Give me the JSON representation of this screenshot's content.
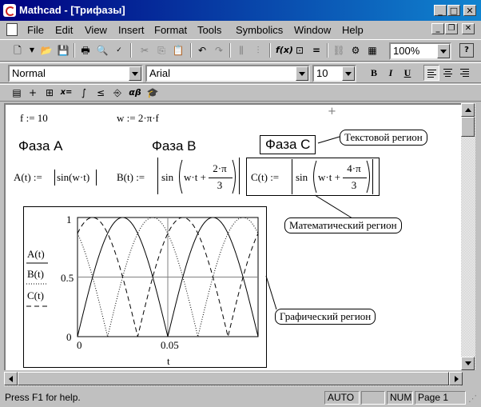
{
  "window": {
    "title": "Mathcad - [Трифазы]"
  },
  "menu": [
    "File",
    "Edit",
    "View",
    "Insert",
    "Format",
    "Tools",
    "Symbolics",
    "Window",
    "Help"
  ],
  "toolbar": {
    "zoom": "100%"
  },
  "format": {
    "style": "Normal",
    "font": "Arial",
    "size": "10",
    "bold": "B",
    "italic": "I",
    "underline": "U"
  },
  "math_palette": {
    "eval": "x=",
    "greek": "αβ"
  },
  "worksheet": {
    "f_def": "f := 10",
    "w_def": "w := 2·π·f",
    "heading_a": "Фаза A",
    "heading_b": "Фаза B",
    "heading_c": "Фаза C",
    "a_def_left": "A(t) :=",
    "a_def_body": "sin(w·t)",
    "b_def_left": "B(t) :=",
    "b_def_sin": "sin",
    "b_def_inner": "w·t +",
    "b_frac_num": "2·π",
    "b_frac_den": "3",
    "c_def_left": "C(t) :=",
    "c_def_sin": "sin",
    "c_def_inner": "w·t +",
    "c_frac_num": "4·π",
    "c_frac_den": "3"
  },
  "callouts": {
    "text_region": "Текстовой регион",
    "math_region": "Математический регион",
    "graph_region": "Графический регион"
  },
  "chart_data": {
    "type": "line",
    "x_range": [
      0,
      0.1
    ],
    "ylim": [
      0,
      1
    ],
    "x_ticks": [
      "0",
      "0.05"
    ],
    "y_ticks": [
      "0",
      "0.5",
      "1"
    ],
    "xlabel": "t",
    "series": [
      {
        "name": "A(t)",
        "formula": "|sin(2·π·10·t)|",
        "style": "solid"
      },
      {
        "name": "B(t)",
        "formula": "|sin(2·π·10·t + 2π/3)|",
        "style": "dotted"
      },
      {
        "name": "C(t)",
        "formula": "|sin(2·π·10·t + 4π/3)|",
        "style": "dashed"
      }
    ]
  },
  "status": {
    "help": "Press F1 for help.",
    "auto": "AUTO",
    "num": "NUM",
    "page": "Page 1"
  }
}
